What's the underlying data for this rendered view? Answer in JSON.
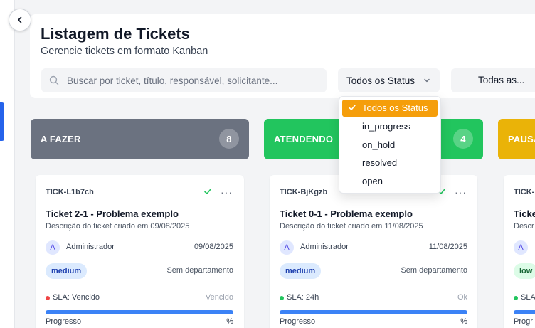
{
  "header": {
    "title": "Listagem de Tickets",
    "subtitle": "Gerencie tickets em formato Kanban"
  },
  "filters": {
    "search_placeholder": "Buscar por ticket, título, responsável, solicitante...",
    "status_value": "Todos os Status",
    "second_value": "Todas as..."
  },
  "status_dropdown": {
    "options": [
      "Todos os Status",
      "in_progress",
      "on_hold",
      "resolved",
      "open"
    ],
    "selected": "Todos os Status"
  },
  "columns": [
    {
      "label": "A FAZER",
      "count": "8",
      "color": "#6b7280"
    },
    {
      "label": "ATENDENDO",
      "count": "4",
      "color": "#22c55e"
    },
    {
      "label": "PAUSA",
      "color": "#eab308"
    }
  ],
  "cards": [
    {
      "code": "TICK-L1b7ch",
      "title": "Ticket 2-1 - Problema exemplo",
      "description": "Descrição do ticket criado em 09/08/2025",
      "avatar": "A",
      "assignee": "Administrador",
      "date": "09/08/2025",
      "priority": "medium",
      "department": "Sem departamento",
      "sla": "SLA: Vencido",
      "sla_status": "Vencido",
      "sla_color": "#ef4444",
      "progress_label": "Progresso",
      "progress_value": "%"
    },
    {
      "code": "TICK-BjKgzb",
      "title": "Ticket 0-1 - Problema exemplo",
      "description": "Descrição do ticket criado em 11/08/2025",
      "avatar": "A",
      "assignee": "Administrador",
      "date": "11/08/2025",
      "priority": "medium",
      "department": "Sem departamento",
      "sla": "SLA: 24h",
      "sla_status": "Ok",
      "sla_color": "#22c55e",
      "progress_label": "Progresso",
      "progress_value": "%"
    },
    {
      "code": "TICK-",
      "title": "Ticke",
      "description": "Descr",
      "avatar": "A",
      "priority": "low",
      "sla": "SLA",
      "sla_color": "#22c55e",
      "progress_label": "Progr"
    }
  ],
  "colors": {
    "accent_orange": "#f59e0b",
    "sidebar_accent": "#2563eb",
    "progress_blue": "#3b82f6"
  },
  "icons": {
    "collapse": "chevron-left-icon",
    "search": "search-icon",
    "status_chevron": "chevron-down-icon",
    "card_check": "check-icon",
    "card_menu": "more-horizontal-icon",
    "dropdown_check": "check-icon"
  }
}
